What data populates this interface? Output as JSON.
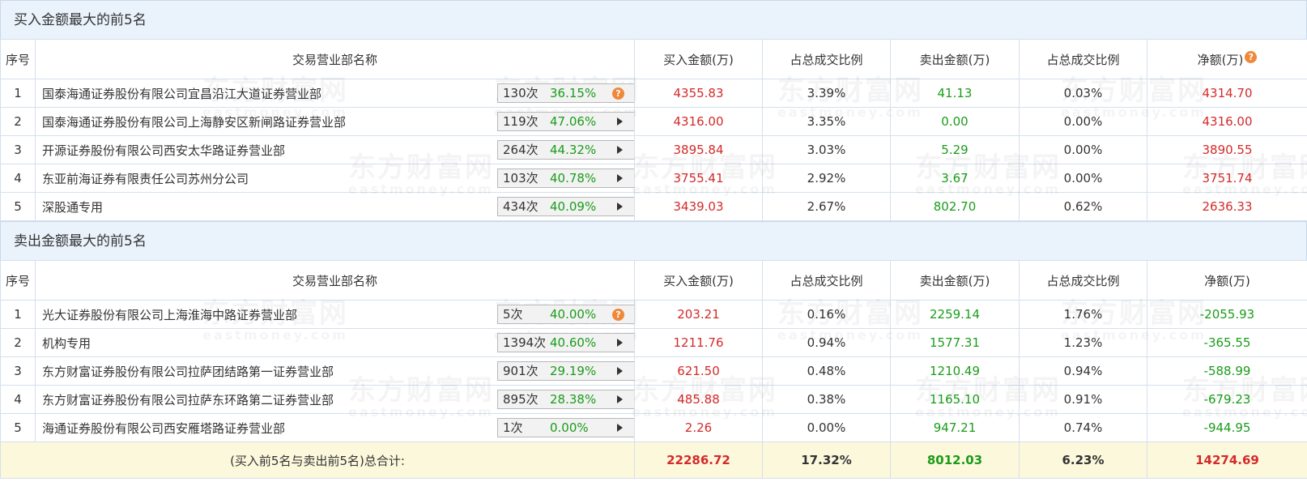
{
  "buy": {
    "title": "买入金额最大的前5名",
    "headers": {
      "idx": "序号",
      "name": "交易营业部名称",
      "buy_amt": "买入金额(万)",
      "buy_pct": "占总成交比例",
      "sell_amt": "卖出金额(万)",
      "sell_pct": "占总成交比例",
      "net": "净额(万)"
    },
    "rows": [
      {
        "idx": "1",
        "name": "国泰海通证券股份有限公司宜昌沿江大道证券营业部",
        "count": "130次",
        "rate": "36.15%",
        "icon": "help-icon",
        "buy": "4355.83",
        "buy_pct": "3.39%",
        "sell": "41.13",
        "sell_pct": "0.03%",
        "net": "4314.70"
      },
      {
        "idx": "2",
        "name": "国泰海通证券股份有限公司上海静安区新闸路证券营业部",
        "count": "119次",
        "rate": "47.06%",
        "icon": "play-arrow-icon",
        "buy": "4316.00",
        "buy_pct": "3.35%",
        "sell": "0.00",
        "sell_pct": "0.00%",
        "net": "4316.00"
      },
      {
        "idx": "3",
        "name": "开源证券股份有限公司西安太华路证券营业部",
        "count": "264次",
        "rate": "44.32%",
        "icon": "play-arrow-icon",
        "buy": "3895.84",
        "buy_pct": "3.03%",
        "sell": "5.29",
        "sell_pct": "0.00%",
        "net": "3890.55"
      },
      {
        "idx": "4",
        "name": "东亚前海证券有限责任公司苏州分公司",
        "count": "103次",
        "rate": "40.78%",
        "icon": "play-arrow-icon",
        "buy": "3755.41",
        "buy_pct": "2.92%",
        "sell": "3.67",
        "sell_pct": "0.00%",
        "net": "3751.74"
      },
      {
        "idx": "5",
        "name": "深股通专用",
        "count": "434次",
        "rate": "40.09%",
        "icon": "play-arrow-icon",
        "buy": "3439.03",
        "buy_pct": "2.67%",
        "sell": "802.70",
        "sell_pct": "0.62%",
        "net": "2636.33"
      }
    ]
  },
  "sell": {
    "title": "卖出金额最大的前5名",
    "headers": {
      "idx": "序号",
      "name": "交易营业部名称",
      "buy_amt": "买入金额(万)",
      "buy_pct": "占总成交比例",
      "sell_amt": "卖出金额(万)",
      "sell_pct": "占总成交比例",
      "net": "净额(万)"
    },
    "rows": [
      {
        "idx": "1",
        "name": "光大证券股份有限公司上海淮海中路证券营业部",
        "count": "5次",
        "rate": "40.00%",
        "icon": "help-icon",
        "buy": "203.21",
        "buy_pct": "0.16%",
        "sell": "2259.14",
        "sell_pct": "1.76%",
        "net": "-2055.93"
      },
      {
        "idx": "2",
        "name": "机构专用",
        "count": "1394次",
        "rate": "40.60%",
        "icon": "play-arrow-icon",
        "buy": "1211.76",
        "buy_pct": "0.94%",
        "sell": "1577.31",
        "sell_pct": "1.23%",
        "net": "-365.55"
      },
      {
        "idx": "3",
        "name": "东方财富证券股份有限公司拉萨团结路第一证券营业部",
        "count": "901次",
        "rate": "29.19%",
        "icon": "play-arrow-icon",
        "buy": "621.50",
        "buy_pct": "0.48%",
        "sell": "1210.49",
        "sell_pct": "0.94%",
        "net": "-588.99"
      },
      {
        "idx": "4",
        "name": "东方财富证券股份有限公司拉萨东环路第二证券营业部",
        "count": "895次",
        "rate": "28.38%",
        "icon": "play-arrow-icon",
        "buy": "485.88",
        "buy_pct": "0.38%",
        "sell": "1165.10",
        "sell_pct": "0.91%",
        "net": "-679.23"
      },
      {
        "idx": "5",
        "name": "海通证券股份有限公司西安雁塔路证券营业部",
        "count": "1次",
        "rate": "0.00%",
        "icon": "play-arrow-icon",
        "buy": "2.26",
        "buy_pct": "0.00%",
        "sell": "947.21",
        "sell_pct": "0.74%",
        "net": "-944.95"
      }
    ]
  },
  "total": {
    "label": "(买入前5名与卖出前5名)总合计:",
    "buy": "22286.72",
    "buy_pct": "17.32%",
    "sell": "8012.03",
    "sell_pct": "6.23%",
    "net": "14274.69"
  },
  "watermark": {
    "cn": "东方财富网",
    "en": "eastmoney.com"
  },
  "colors": {
    "positive": "#d42a2a",
    "negative": "#1a9c1a",
    "header_bg": "#eaf2fb",
    "total_bg": "#fcf8dc",
    "help_icon": "#f0883a"
  }
}
